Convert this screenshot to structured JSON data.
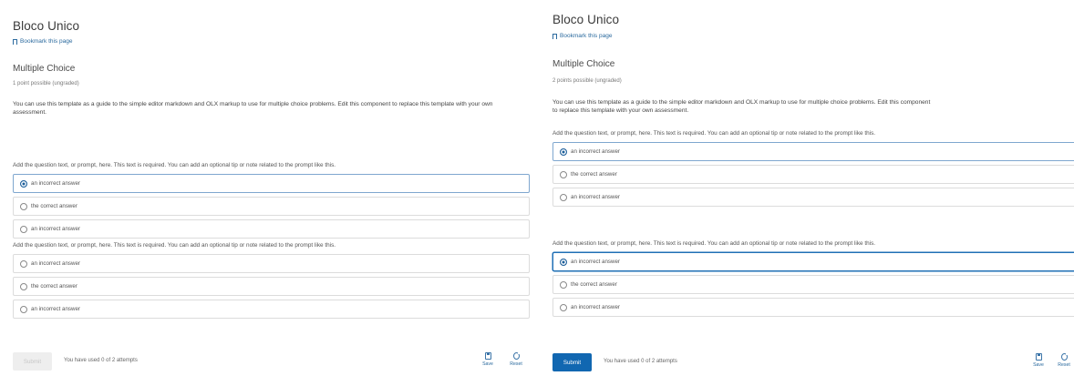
{
  "left": {
    "unit_title": "Bloco Unico",
    "bookmark": "Bookmark this page",
    "problem_title": "Multiple Choice",
    "points": "1 point possible (ungraded)",
    "intro": "You can use this template as a guide to the simple editor markdown and OLX markup to use for multiple choice problems. Edit this component to replace this template with your own assessment.",
    "questions": [
      {
        "prompt": "Add the question text, or prompt, here. This text is required. You can add an optional tip or note related to the prompt like this.",
        "options": [
          {
            "label": "an incorrect answer",
            "checked": true
          },
          {
            "label": "the correct answer",
            "checked": false
          },
          {
            "label": "an incorrect answer",
            "checked": false
          }
        ]
      },
      {
        "prompt": "Add the question text, or prompt, here. This text is required. You can add an optional tip or note related to the prompt like this.",
        "options": [
          {
            "label": "an incorrect answer",
            "checked": false
          },
          {
            "label": "the correct answer",
            "checked": false
          },
          {
            "label": "an incorrect answer",
            "checked": false
          }
        ]
      }
    ],
    "submit_label": "Submit",
    "attempts": "You have used 0 of 2 attempts",
    "save_label": "Save",
    "reset_label": "Reset"
  },
  "right": {
    "unit_title": "Bloco Unico",
    "bookmark": "Bookmark this page",
    "problem_title": "Multiple Choice",
    "points": "2 points possible (ungraded)",
    "intro_line1": "You can use this template as a guide to the simple editor markdown and OLX markup to use for multiple choice problems. Edit this component",
    "intro_line2": "to replace this template with your own assessment.",
    "questions": [
      {
        "prompt": "Add the question text, or prompt, here. This text is required. You can add an optional tip or note related to the prompt like this.",
        "options": [
          {
            "label": "an incorrect answer",
            "checked": true
          },
          {
            "label": "the correct answer",
            "checked": false
          },
          {
            "label": "an incorrect answer",
            "checked": false
          }
        ]
      },
      {
        "prompt": "Add the question text, or prompt, here. This text is required. You can add an optional tip or note related to the prompt like this.",
        "options": [
          {
            "label": "an incorrect answer",
            "checked": true
          },
          {
            "label": "the correct answer",
            "checked": false
          },
          {
            "label": "an incorrect answer",
            "checked": false
          }
        ]
      }
    ],
    "submit_label": "Submit",
    "attempts": "You have used 0 of 2 attempts",
    "save_label": "Save",
    "reset_label": "Reset"
  },
  "colors": {
    "accent": "#1167b1",
    "link": "#2b6a9e",
    "border": "#dcdcdc",
    "disabled_bg": "#eeeeee"
  }
}
